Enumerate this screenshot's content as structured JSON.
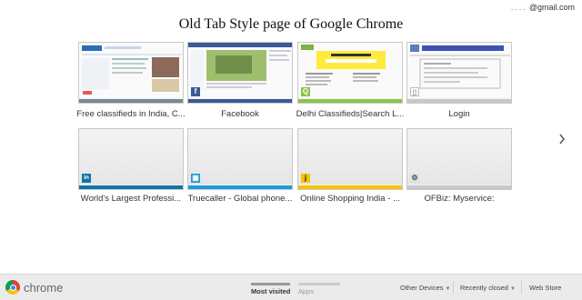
{
  "page_title": "Old Tab Style page of Google Chrome",
  "account": {
    "dots": "....",
    "email": "@gmail.com"
  },
  "tiles": [
    {
      "label": "Free classifieds in India, C...",
      "accent": "#7b8794"
    },
    {
      "label": "Facebook",
      "accent": "#3b5998",
      "favicon": "f"
    },
    {
      "label": "Delhi Classifieds|Search L...",
      "accent": "#8bc34a",
      "favicon": "Q"
    },
    {
      "label": "Login",
      "accent": "#9e9e9e",
      "favicon": "▯"
    },
    {
      "label": "World's Largest Professi...",
      "accent": "#0e76a8",
      "favicon": "in"
    },
    {
      "label": "Truecaller - Global phone...",
      "accent": "#1e9bd7",
      "favicon": "▣"
    },
    {
      "label": "Online Shopping India - ...",
      "accent": "#f5c400",
      "favicon": "j"
    },
    {
      "label": "OFBiz: Myservice:",
      "accent": "#607d8b",
      "favicon": "⚙"
    }
  ],
  "next_icon": "chevron-right-icon",
  "footer": {
    "brand": "chrome",
    "tab_most_visited": "Most visited",
    "tab_apps": "Apps",
    "other_devices": "Other Devices",
    "recently_closed": "Recently closed",
    "web_store": "Web Store",
    "caret": "▼"
  }
}
